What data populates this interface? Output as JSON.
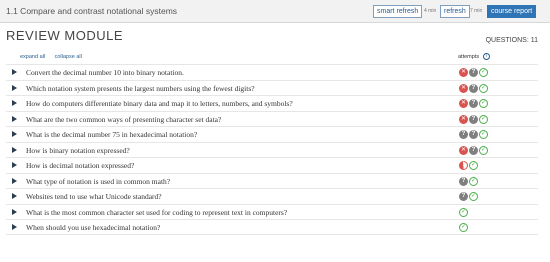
{
  "topbar": {
    "breadcrumb": "1.1 Compare and contrast notational systems",
    "smart_refresh_label": "smart refresh",
    "smart_refresh_time": "4 min",
    "refresh_label": "refresh",
    "refresh_time": "7 min",
    "course_report_label": "course report"
  },
  "module": {
    "title": "REVIEW MODULE",
    "questions_count": "QUESTIONS: 11",
    "expand_all": "expand all",
    "collapse_all": "collapse all",
    "attempts_header": "attempts",
    "info_glyph": "i"
  },
  "icon_glyphs": {
    "wrong": "✕",
    "unknown": "?",
    "right": "✓",
    "partial": "!"
  },
  "questions": [
    {
      "text": "Convert the decimal number 10 into binary notation.",
      "attempts": [
        "wrong",
        "unknown",
        "right"
      ]
    },
    {
      "text": "Which notation system presents the largest numbers using the fewest digits?",
      "attempts": [
        "wrong",
        "unknown",
        "right"
      ]
    },
    {
      "text": "How do computers differentiate binary data and map it to letters, numbers, and symbols?",
      "attempts": [
        "wrong",
        "unknown",
        "right"
      ]
    },
    {
      "text": "What are the two common ways of presenting character set data?",
      "attempts": [
        "wrong",
        "unknown",
        "right"
      ]
    },
    {
      "text": "What is the decimal number 75 in hexadecimal notation?",
      "attempts": [
        "unknown",
        "unknown",
        "right"
      ]
    },
    {
      "text": "How is binary notation expressed?",
      "attempts": [
        "wrong",
        "unknown",
        "right"
      ]
    },
    {
      "text": "How is decimal notation expressed?",
      "attempts": [
        "partial",
        "right"
      ]
    },
    {
      "text": "What type of notation is used in common math?",
      "attempts": [
        "unknown",
        "right"
      ]
    },
    {
      "text": "Websites tend to use what Unicode standard?",
      "attempts": [
        "unknown",
        "right"
      ]
    },
    {
      "text": "What is the most common character set used for coding to represent text in computers?",
      "attempts": [
        "right"
      ]
    },
    {
      "text": "When should you use hexadecimal notation?",
      "attempts": [
        "right"
      ]
    }
  ]
}
